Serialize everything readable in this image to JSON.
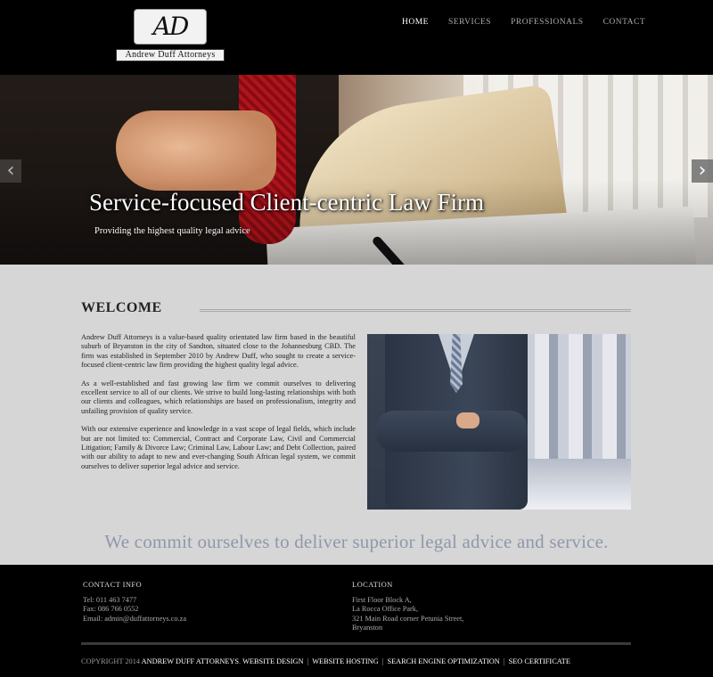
{
  "header": {
    "logo_monogram": "AD",
    "logo_name": "Andrew Duff Attorneys",
    "nav": [
      {
        "label": "HOME",
        "active": true
      },
      {
        "label": "SERVICES",
        "active": false
      },
      {
        "label": "PROFESSIONALS",
        "active": false
      },
      {
        "label": "CONTACT",
        "active": false
      }
    ]
  },
  "hero": {
    "title": "Service-focused Client-centric Law Firm",
    "subtitle": "Providing the highest quality legal advice",
    "prev_icon": "chevron-left-icon",
    "next_icon": "chevron-right-icon"
  },
  "welcome": {
    "heading": "WELCOME",
    "paragraphs": [
      "Andrew Duff Attorneys is a value-based quality orientated law firm based in the beautiful suburb of Bryanston in the city of Sandton, situated close to the Johannesburg CBD. The firm was established in September 2010 by Andrew Duff, who sought to create a service-focused client-centric law firm providing the highest quality legal advice.",
      "As a well-established and fast growing law firm we commit ourselves to delivering excellent service to all of our clients. We strive to build long-lasting relationships with both our clients and colleagues, which relationships are based on professionalism, integrity and unfailing provision of quality service.",
      "With our extensive experience and knowledge in a vast scope of legal fields, which include but are not limited to: Commercial, Contract and Corporate Law, Civil and Commercial Litigation; Family & Divorce Law; Criminal Law, Labour Law; and Debt Collection, paired with our ability to adapt to new and ever-changing South African legal system, we commit ourselves to deliver superior legal advice and service."
    ]
  },
  "tagline": "We commit ourselves to deliver superior legal advice and service.",
  "footer": {
    "contact_heading": "CONTACT INFO",
    "contact_lines": [
      "Tel: 011 463 7477",
      "Fax: 086 766 0552",
      "Email: admin@duffattorneys.co.za"
    ],
    "location_heading": "LOCATION",
    "location_lines": [
      "First Floor Block A,",
      "La Rocca Office Park,",
      "321 Main Road corner Petunia Street,",
      "Bryanston"
    ],
    "copyright_prefix": "COPYRIGHT 2014",
    "copyright_name": "ANDREW DUFF ATTORNEYS",
    "copyright_dot": ".",
    "links": [
      "WEBSITE DESIGN",
      "WEBSITE HOSTING",
      "SEARCH ENGINE OPTIMIZATION",
      "SEO CERTIFICATE"
    ],
    "separator": "|"
  },
  "colors": {
    "header_bg": "#000000",
    "body_bg": "#d6d6d6",
    "tagline": "#8f98ab",
    "nav_active": "#ffffff",
    "nav_inactive": "#aaaaaa"
  }
}
